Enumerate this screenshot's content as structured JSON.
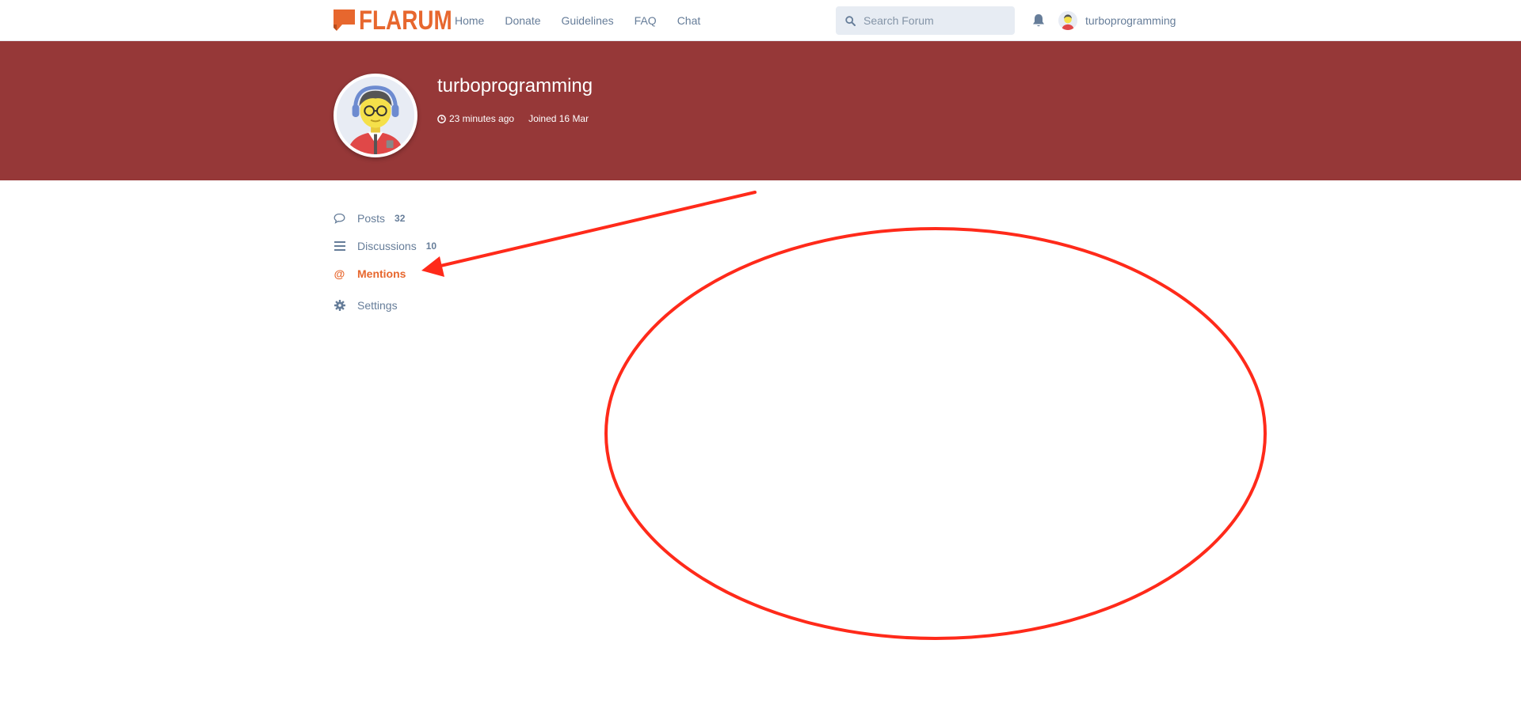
{
  "header": {
    "brand": "FLARUM",
    "nav": [
      "Home",
      "Donate",
      "Guidelines",
      "FAQ",
      "Chat"
    ],
    "search_placeholder": "Search Forum",
    "username": "turboprogramming"
  },
  "profile": {
    "username": "turboprogramming",
    "last_seen": "23 minutes ago",
    "joined": "Joined 16 Mar"
  },
  "sidebar": {
    "items": [
      {
        "label": "Posts",
        "count": "32",
        "icon": "comment-icon"
      },
      {
        "label": "Discussions",
        "count": "10",
        "icon": "list-icon"
      },
      {
        "label": "Mentions",
        "icon": "at-icon",
        "active": true
      },
      {
        "label": "Settings",
        "icon": "gear-icon"
      }
    ]
  },
  "colors": {
    "brand": "#e7672e",
    "hero": "#963838",
    "text": "#667d99",
    "annotation": "#ff2a1a"
  }
}
